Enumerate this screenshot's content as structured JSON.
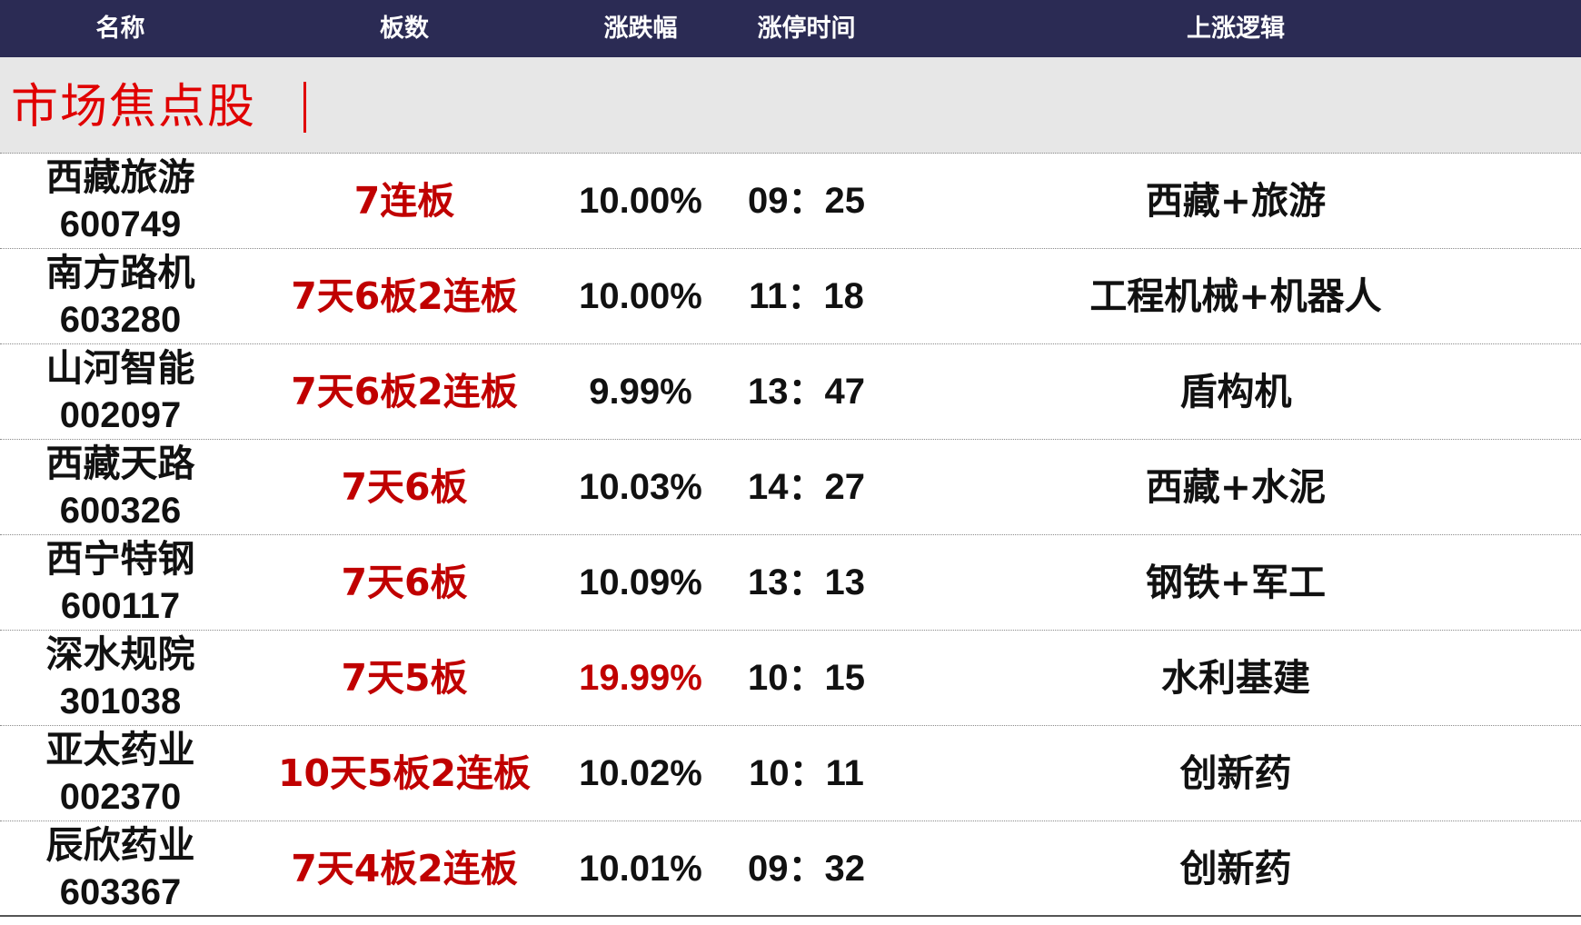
{
  "header": {
    "col_name": "名称",
    "col_boards": "板数",
    "col_change": "涨跌幅",
    "col_limit_time": "涨停时间",
    "col_logic": "上涨逻辑"
  },
  "section": {
    "title": "市场焦点股"
  },
  "colors": {
    "header_bg": "#2b2b54",
    "banner_bg": "#e7e7e7",
    "accent_red": "#c00000"
  },
  "rows": [
    {
      "name": "西藏旅游",
      "code": "600749",
      "boards": "7连板",
      "change": "10.00%",
      "change_highlight": false,
      "time": "09：25",
      "logic": "西藏+旅游"
    },
    {
      "name": "南方路机",
      "code": "603280",
      "boards": "7天6板2连板",
      "change": "10.00%",
      "change_highlight": false,
      "time": "11：18",
      "logic": "工程机械+机器人"
    },
    {
      "name": "山河智能",
      "code": "002097",
      "boards": "7天6板2连板",
      "change": "9.99%",
      "change_highlight": false,
      "time": "13：47",
      "logic": "盾构机"
    },
    {
      "name": "西藏天路",
      "code": "600326",
      "boards": "7天6板",
      "change": "10.03%",
      "change_highlight": false,
      "time": "14：27",
      "logic": "西藏+水泥"
    },
    {
      "name": "西宁特钢",
      "code": "600117",
      "boards": "7天6板",
      "change": "10.09%",
      "change_highlight": false,
      "time": "13：13",
      "logic": "钢铁+军工"
    },
    {
      "name": "深水规院",
      "code": "301038",
      "boards": "7天5板",
      "change": "19.99%",
      "change_highlight": true,
      "time": "10：15",
      "logic": "水利基建"
    },
    {
      "name": "亚太药业",
      "code": "002370",
      "boards": "10天5板2连板",
      "change": "10.02%",
      "change_highlight": false,
      "time": "10：11",
      "logic": "创新药"
    },
    {
      "name": "辰欣药业",
      "code": "603367",
      "boards": "7天4板2连板",
      "change": "10.01%",
      "change_highlight": false,
      "time": "09：32",
      "logic": "创新药"
    }
  ]
}
